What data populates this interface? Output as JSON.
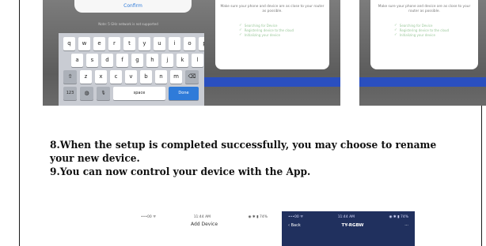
{
  "keyboard_shot": {
    "dialog_button": "Confirm",
    "hint": "Note: 5 GHz network is not supported",
    "rows": [
      [
        "q",
        "w",
        "e",
        "r",
        "t",
        "y",
        "u",
        "i",
        "o",
        "p"
      ],
      [
        "a",
        "s",
        "d",
        "f",
        "g",
        "h",
        "j",
        "k",
        "l"
      ]
    ],
    "row3_letters": [
      "z",
      "x",
      "c",
      "v",
      "b",
      "n",
      "m"
    ],
    "shift_icon": "⇧",
    "delete_icon": "⌫",
    "num_key": "123",
    "globe_icon": "◍",
    "mic_icon": "🎙",
    "space_label": "space",
    "done_label": "Done"
  },
  "connect_shot_a": {
    "text": "Make sure your phone and device are as close to your router as possible.",
    "steps": [
      "Searching for Device",
      "Registering device to the cloud",
      "Initializing your device"
    ]
  },
  "connect_shot_b": {
    "text": "Make sure your phone and device are as close to your router as possible.",
    "steps": [
      "Searching for Device",
      "Registering device to the cloud",
      "Initializing your device"
    ]
  },
  "instructions": {
    "line1": "8.When the setup is completed successfully, you may choose to rename",
    "line2": "your new device.",
    "line3": "9.You can now control your device with the App."
  },
  "add_device_shot": {
    "carrier": "•••00 ᯤ",
    "time": "11:44 AM",
    "battery": "◉ ✱ ▮ 74%",
    "title": "Add Device"
  },
  "device_panel_shot": {
    "carrier": "•••00 ᯤ",
    "time": "11:44 AM",
    "battery": "◉ ✱ ▮ 74%",
    "back_label": "‹ Back",
    "title": "TY-RGBW",
    "more_icon": "···"
  },
  "colors": {
    "accent_blue": "#2f7bd9",
    "progress_blue": "#2a4fbf",
    "panel_dark": "#20305e",
    "step_green": "#9ac89a"
  }
}
